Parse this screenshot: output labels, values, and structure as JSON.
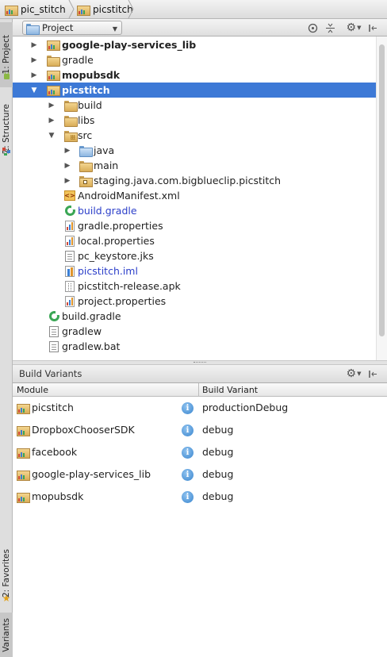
{
  "breadcrumb": {
    "items": [
      "pic_stitch",
      "picstitch"
    ]
  },
  "left_strip": {
    "tabs": [
      "1: Project",
      "Z: Structure",
      "2: Favorites",
      "Variants"
    ]
  },
  "project_toolbar": {
    "view_mode": "Project",
    "icons": [
      "target-icon",
      "collapse-all-icon",
      "gear-icon",
      "hide-icon"
    ]
  },
  "tree": {
    "items": [
      {
        "label": "google-play-services_lib",
        "icon": "module-icon",
        "expand": "collapsed",
        "bold": true
      },
      {
        "label": "gradle",
        "icon": "folder-icon",
        "expand": "collapsed"
      },
      {
        "label": "mopubsdk",
        "icon": "module-icon",
        "expand": "collapsed",
        "bold": true
      },
      {
        "label": "picstitch",
        "icon": "module-icon",
        "expand": "expanded",
        "bold": true,
        "selected": true
      },
      {
        "label": "build",
        "icon": "folder-icon",
        "expand": "collapsed"
      },
      {
        "label": "libs",
        "icon": "folder-icon",
        "expand": "collapsed"
      },
      {
        "label": "src",
        "icon": "source-folder-icon",
        "expand": "expanded"
      },
      {
        "label": "java",
        "icon": "blue-folder-icon",
        "expand": "collapsed"
      },
      {
        "label": "main",
        "icon": "folder-icon",
        "expand": "collapsed"
      },
      {
        "label": "staging.java.com.bigblueclip.picstitch",
        "icon": "package-folder-icon",
        "expand": "collapsed"
      },
      {
        "label": "AndroidManifest.xml",
        "icon": "xml-icon"
      },
      {
        "label": "build.gradle",
        "icon": "gradle-icon",
        "blue": true
      },
      {
        "label": "gradle.properties",
        "icon": "properties-icon"
      },
      {
        "label": "local.properties",
        "icon": "properties-icon"
      },
      {
        "label": "pc_keystore.jks",
        "icon": "file-icon"
      },
      {
        "label": "picstitch.iml",
        "icon": "iml-icon",
        "blue": true
      },
      {
        "label": "picstitch-release.apk",
        "icon": "apk-icon"
      },
      {
        "label": "project.properties",
        "icon": "properties-icon"
      },
      {
        "label": "build.gradle",
        "icon": "gradle-icon"
      },
      {
        "label": "gradlew",
        "icon": "file-icon"
      },
      {
        "label": "gradlew.bat",
        "icon": "file-icon"
      }
    ]
  },
  "build_variants": {
    "title": "Build Variants",
    "columns": [
      "Module",
      "Build Variant"
    ],
    "rows": [
      {
        "module": "picstitch",
        "variant": "productionDebug"
      },
      {
        "module": "DropboxChooserSDK",
        "variant": "debug"
      },
      {
        "module": "facebook",
        "variant": "debug"
      },
      {
        "module": "google-play-services_lib",
        "variant": "debug"
      },
      {
        "module": "mopubsdk",
        "variant": "debug"
      }
    ]
  },
  "colors": {
    "selection": "#3d79d6",
    "blue_text": "#2b3ec9",
    "info_icon": "#3a86cf"
  }
}
